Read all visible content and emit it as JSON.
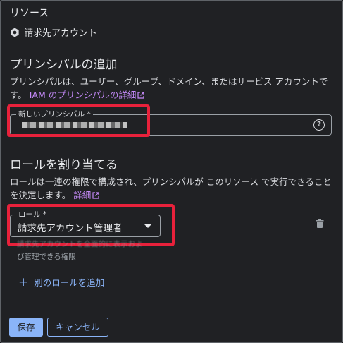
{
  "resource": {
    "heading": "リソース",
    "name": "請求先アカウント",
    "icon": "hexagon-resource-icon"
  },
  "principals": {
    "title": "プリンシパルの追加",
    "description": "プリンシパルは、ユーザー、グループ、ドメイン、またはサービス アカウントです。",
    "link_text": "IAM のプリンシパルの詳細",
    "field_label": "新しいプリンシパル *",
    "help_icon": "help-icon"
  },
  "roles": {
    "title": "ロールを割り当てる",
    "description": "ロールは一連の権限で構成され、プリンシパルが このリソース で実行できることを決定します。",
    "link_text": "詳細",
    "field_label": "ロール *",
    "selected_role": "請求先アカウント管理者",
    "hint_line1": "請求先アカウントを全面的に表示およ",
    "hint_line2": "び管理できる権限",
    "add_role_label": "別のロールを追加"
  },
  "actions": {
    "save_label": "保存",
    "cancel_label": "キャンセル"
  },
  "colors": {
    "background": "#202124",
    "link": "#c58af9",
    "accent": "#8ab4f8",
    "highlight": "#e8213b"
  }
}
